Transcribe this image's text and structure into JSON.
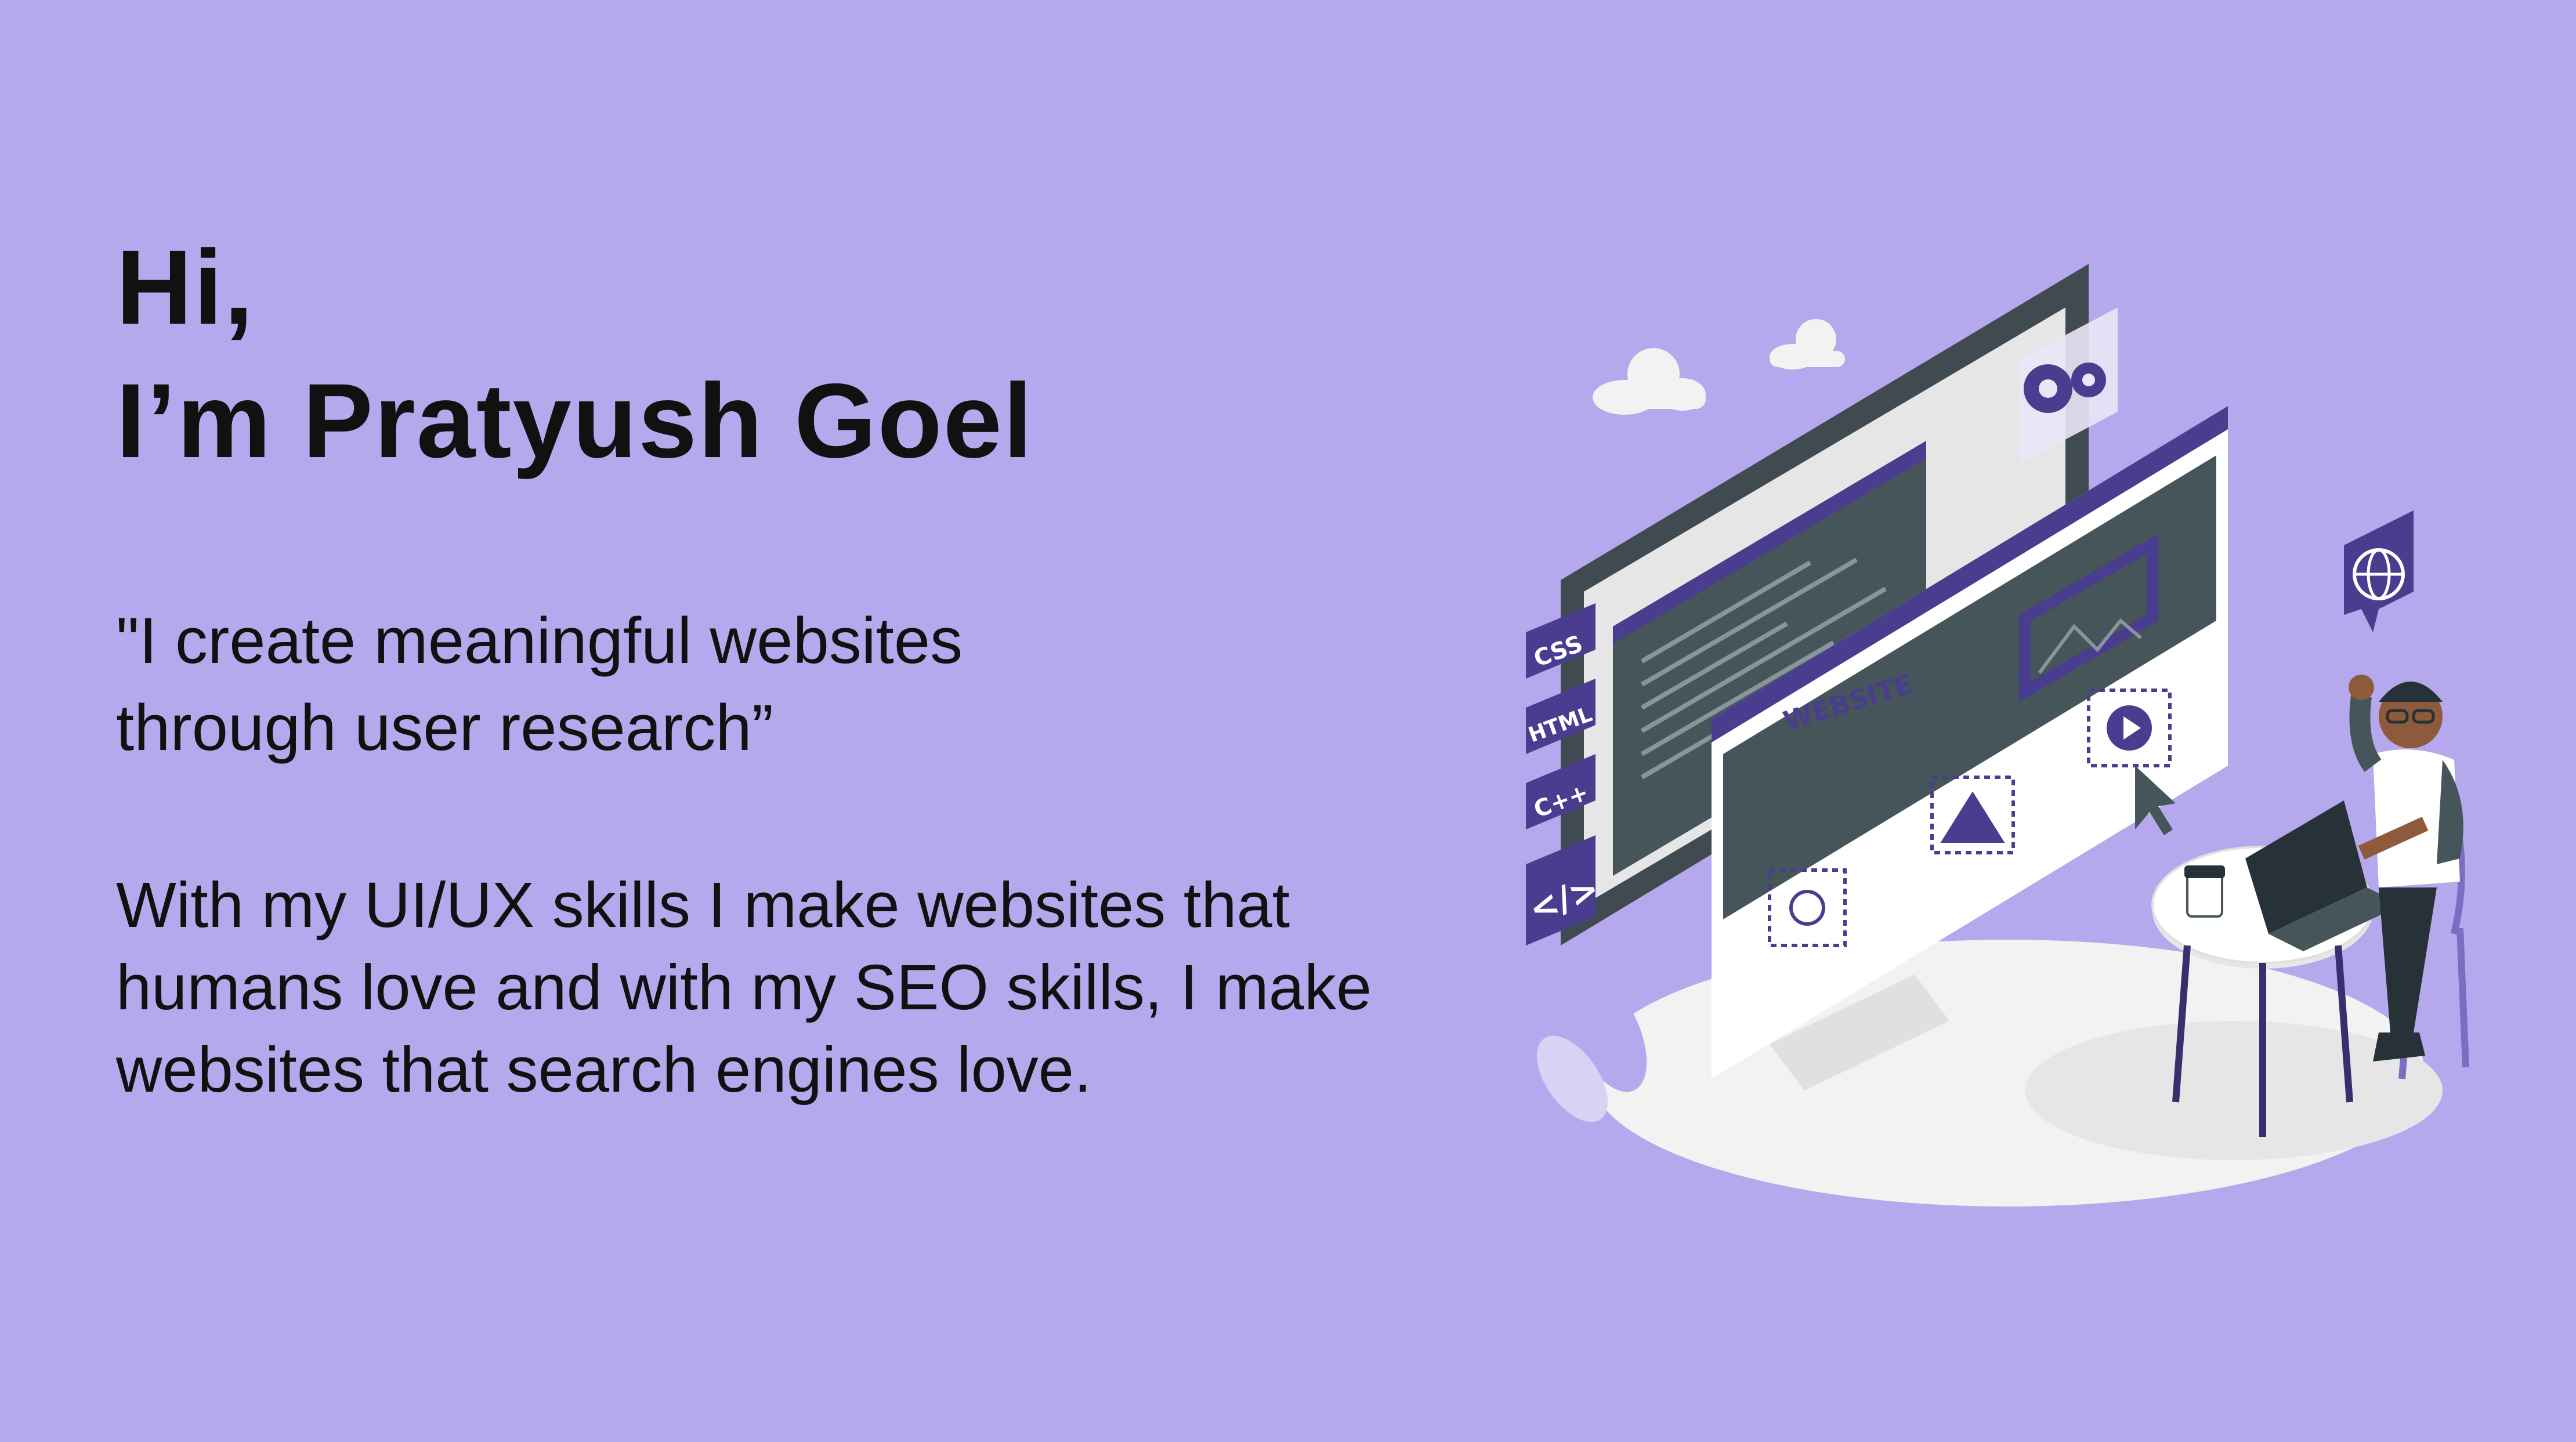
{
  "hero": {
    "greeting": "Hi,",
    "name": "I’m Pratyush Goel",
    "tagline_line1": "\"I create meaningful websites",
    "tagline_line2": "through user research”",
    "description": "With my UI/UX skills I make websites that humans love and with my SEO skills, I make websites that search engines love."
  },
  "illustration": {
    "tags": [
      "CSS",
      "HTML",
      "C++"
    ],
    "code_tag": "</>",
    "site_label": "WEBSITE",
    "icons": [
      "gear-icon",
      "image-icon",
      "play-icon",
      "globe-icon",
      "cursor-icon"
    ]
  },
  "colors": {
    "background": "#b5a8ec",
    "text": "#111111",
    "accent_purple": "#4a3d8f",
    "dark_slate": "#455559",
    "floor": "#f2f2f2"
  }
}
